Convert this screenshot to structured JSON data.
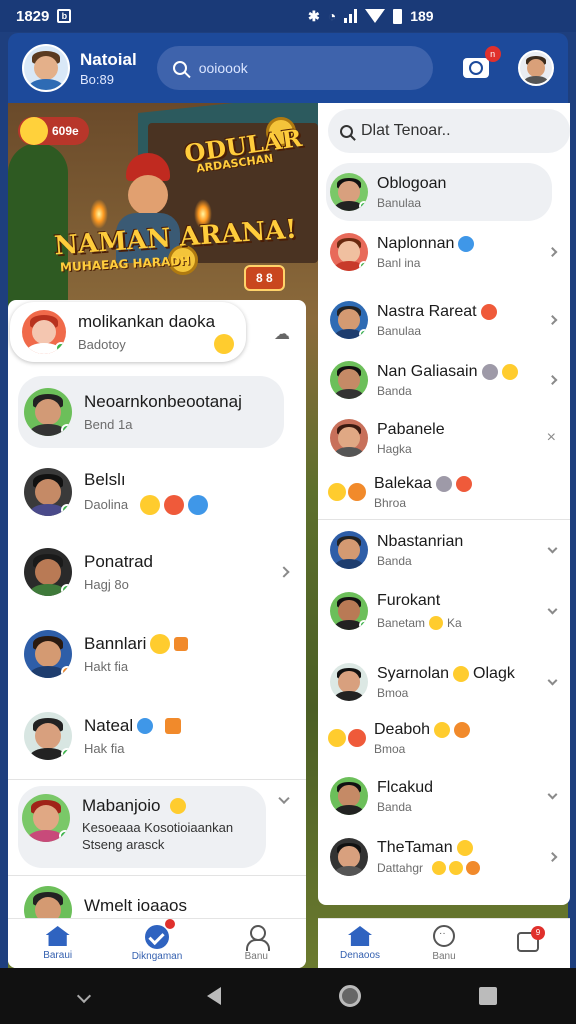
{
  "status": {
    "time": "1829",
    "notif_glyph": "b",
    "right_text": "189"
  },
  "header": {
    "name": "Natoial",
    "sub": "Bo:89",
    "search_placeholder": "ooioook",
    "camera_badge": "n"
  },
  "banner": {
    "pill_left": "609e",
    "title_top": "ODULAR",
    "title_top_sub": "ARDASCHAN",
    "title_main": "NAMAN ARANA!",
    "title_main_sub": "MUHAEAG HARADH",
    "pill_right": "8 8"
  },
  "left_list": [
    {
      "name": "molikankan daoka",
      "sub": "Badotoy"
    },
    {
      "name": "Neoarnkonbeootanaj",
      "sub": "Bend 1a"
    },
    {
      "name": "Belslı",
      "sub": "Daolina"
    },
    {
      "name": "Ponatrad",
      "sub": "Hagj 8o"
    },
    {
      "name": "Bannlari",
      "sub": "Hakt fia"
    },
    {
      "name": "Nateal",
      "sub": "Hak fia"
    },
    {
      "name": "Mabanjoio",
      "sub": "Kesoeaaa Kosotioiaankan",
      "sub2": "Stseng arasck"
    },
    {
      "name": "Wmelt ioaaos",
      "sub": ""
    }
  ],
  "right_search": "Dlat Tenoar..",
  "right_list": [
    {
      "name": "Oblogoan",
      "sub": "Banulaa"
    },
    {
      "name": "Naplonnan",
      "sub": "Banl ina"
    },
    {
      "name": "Nastra Rareat",
      "sub": "Banulaa"
    },
    {
      "name": "Nan Galiasain",
      "sub": "Banda"
    },
    {
      "name": "Pabanele",
      "sub": "Hagka"
    },
    {
      "name": "Balekaa",
      "sub": "Bhroa"
    },
    {
      "name": "Nbastanrian",
      "sub": "Banda"
    },
    {
      "name": "Furokant",
      "sub": "Banetam",
      "sub_extra": "Ka"
    },
    {
      "name": "Syarnolan",
      "sub": "Bmoa",
      "name_extra": "Olagk"
    },
    {
      "name": "Deaboh",
      "sub": "Bmoa"
    },
    {
      "name": "Flcakud",
      "sub": "Banda"
    },
    {
      "name": "TheTaman",
      "sub": "Dattahgr"
    }
  ],
  "nav_left": [
    {
      "label": "Baraui",
      "icon": "home-icon"
    },
    {
      "label": "Dikngaman",
      "icon": "check-icon"
    },
    {
      "label": "Banu",
      "icon": "person-icon"
    }
  ],
  "nav_right": [
    {
      "label": "Denaoos",
      "icon": "home-icon"
    },
    {
      "label": "Banu",
      "icon": "circle-icon"
    },
    {
      "label": "",
      "icon": "chat-icon",
      "badge": "9"
    }
  ],
  "colors": {
    "brand": "#1d4a9b",
    "accent": "#2f63c0",
    "online": "#3cb44b",
    "badge": "#e0302c"
  }
}
